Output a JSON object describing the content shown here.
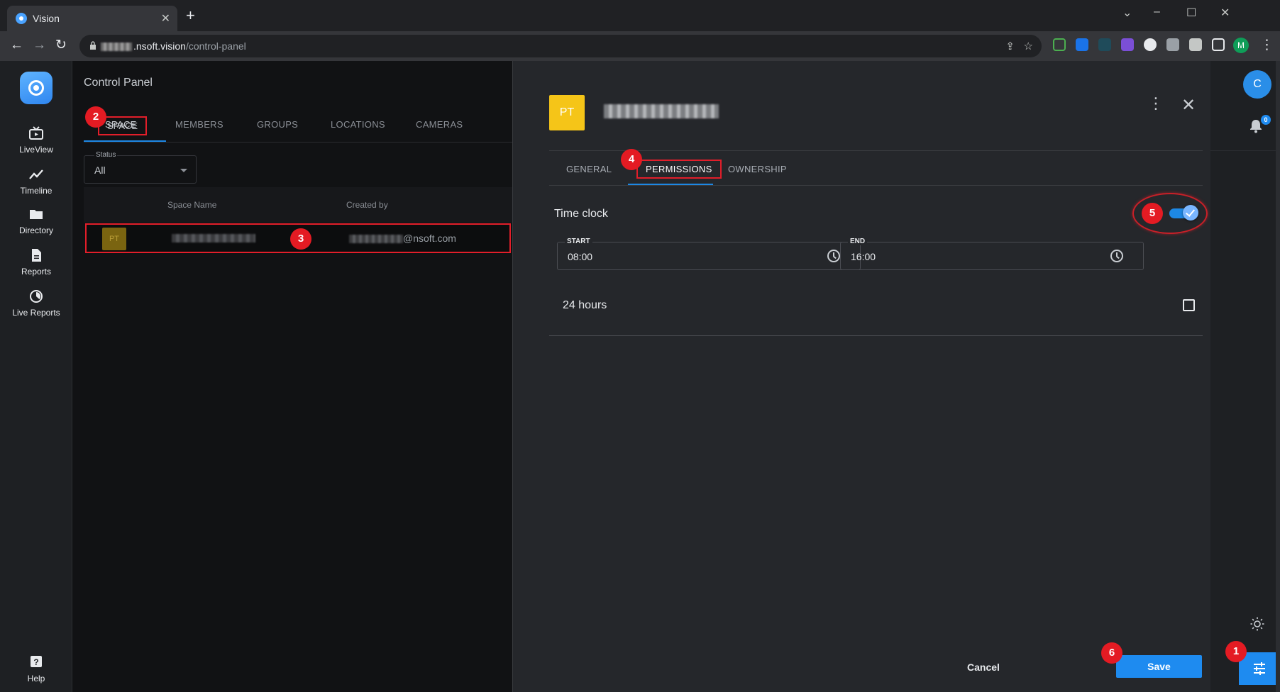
{
  "browser": {
    "tab_title": "Vision",
    "tab_close": "✕",
    "new_tab": "+",
    "url_host": ".nsoft.vision",
    "url_path": "/control-panel",
    "profile_initial": "M",
    "window_controls": [
      "⌄",
      "–",
      "☐",
      "✕"
    ]
  },
  "leftnav": {
    "items": [
      {
        "label": "LiveView",
        "icon": "tv-icon"
      },
      {
        "label": "Timeline",
        "icon": "trend-icon"
      },
      {
        "label": "Directory",
        "icon": "folder-icon"
      },
      {
        "label": "Reports",
        "icon": "document-icon"
      },
      {
        "label": "Live Reports",
        "icon": "pie-icon"
      }
    ],
    "help_label": "Help"
  },
  "control_panel": {
    "title": "Control Panel",
    "tabs": [
      "SPACE",
      "MEMBERS",
      "GROUPS",
      "LOCATIONS",
      "CAMERAS"
    ],
    "status_filter": {
      "label": "Status",
      "value": "All"
    },
    "columns": [
      "Space Name",
      "Created by"
    ],
    "row": {
      "avatar": "PT",
      "created_by_domain": "@nsoft.com"
    }
  },
  "space_detail": {
    "avatar": "PT",
    "tabs": [
      "GENERAL",
      "PERMISSIONS",
      "OWNERSHIP"
    ],
    "time_clock_label": "Time clock",
    "time_clock_enabled": true,
    "start": {
      "label": "START",
      "value": "08:00"
    },
    "end": {
      "label": "END",
      "value": "16:00"
    },
    "hours_label": "24 hours",
    "hours_checked": false,
    "more_icon": "⋮",
    "close_icon": "✕",
    "cancel_label": "Cancel",
    "save_label": "Save"
  },
  "rightrail": {
    "user_initial": "C",
    "notification_count": "0"
  },
  "markers": [
    "1",
    "2",
    "3",
    "4",
    "5",
    "6"
  ],
  "colors": {
    "accent": "#1e8bf0",
    "marker_red": "#e41b23",
    "space_avatar": "#f5c518"
  }
}
